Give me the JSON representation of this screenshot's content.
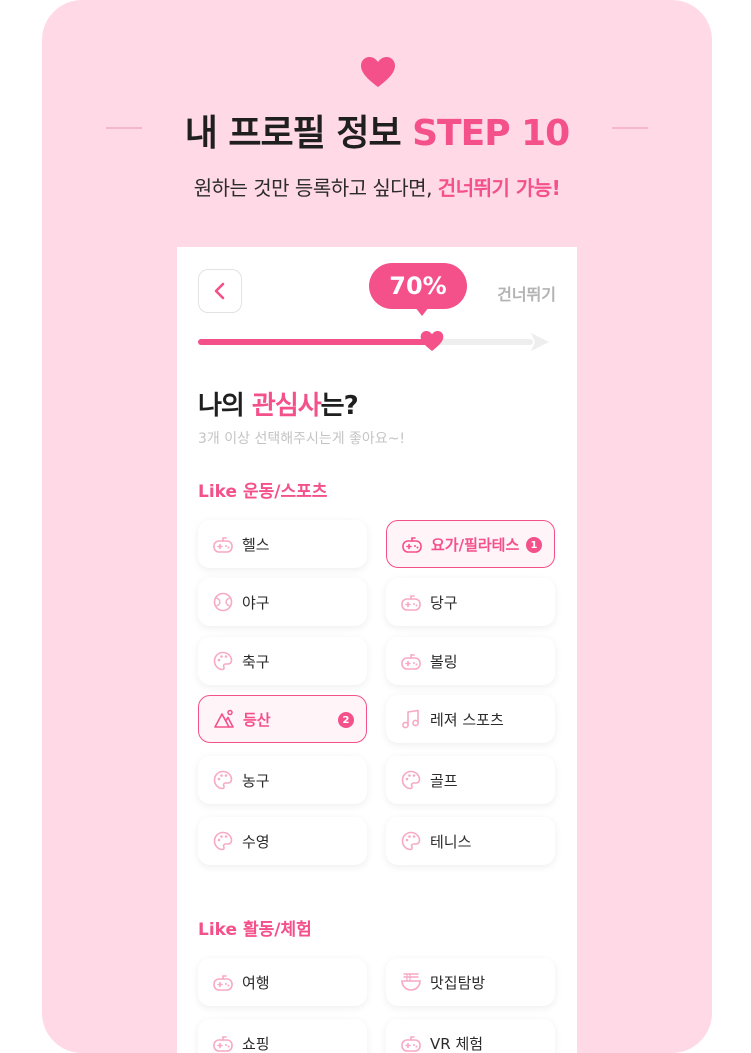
{
  "header": {
    "title_main": "내 프로필 정보",
    "title_step": "STEP 10",
    "subtitle_main": "원하는 것만 등록하고 싶다면,",
    "subtitle_accent": "건너뛰기 가능!"
  },
  "screen": {
    "progress_label": "70%",
    "progress_value": 0.7,
    "skip_label": "건너뛰기",
    "question_prefix": "나의 ",
    "question_accent": "관심사",
    "question_suffix": "는?",
    "hint": "3개 이상 선택해주시는게 좋아요~!"
  },
  "sections": [
    {
      "title": "Like 운동/스포츠",
      "chips": [
        {
          "label": "헬스",
          "icon": "game-controller-icon",
          "selected": false,
          "badge": ""
        },
        {
          "label": "요가/필라테스",
          "icon": "game-controller-icon",
          "selected": true,
          "badge": "1"
        },
        {
          "label": "야구",
          "icon": "ball-icon",
          "selected": false,
          "badge": ""
        },
        {
          "label": "당구",
          "icon": "game-controller-icon",
          "selected": false,
          "badge": ""
        },
        {
          "label": "축구",
          "icon": "palette-icon",
          "selected": false,
          "badge": ""
        },
        {
          "label": "볼링",
          "icon": "game-controller-icon",
          "selected": false,
          "badge": ""
        },
        {
          "label": "등산",
          "icon": "mountain-icon",
          "selected": true,
          "badge": "2"
        },
        {
          "label": "레져 스포츠",
          "icon": "music-note-icon",
          "selected": false,
          "badge": ""
        },
        {
          "label": "농구",
          "icon": "palette-icon",
          "selected": false,
          "badge": ""
        },
        {
          "label": "골프",
          "icon": "palette-icon",
          "selected": false,
          "badge": ""
        },
        {
          "label": "수영",
          "icon": "palette-icon",
          "selected": false,
          "badge": ""
        },
        {
          "label": "테니스",
          "icon": "palette-icon",
          "selected": false,
          "badge": ""
        }
      ]
    },
    {
      "title": "Like 활동/체험",
      "chips": [
        {
          "label": "여행",
          "icon": "game-controller-icon",
          "selected": false,
          "badge": ""
        },
        {
          "label": "맛집탐방",
          "icon": "noodle-bowl-icon",
          "selected": false,
          "badge": ""
        },
        {
          "label": "쇼핑",
          "icon": "game-controller-icon",
          "selected": false,
          "badge": ""
        },
        {
          "label": "VR 체험",
          "icon": "game-controller-icon",
          "selected": false,
          "badge": ""
        }
      ]
    }
  ],
  "colors": {
    "accent": "#f4508a",
    "background": "#ffd9e6",
    "icon": "#f7a9c5"
  }
}
